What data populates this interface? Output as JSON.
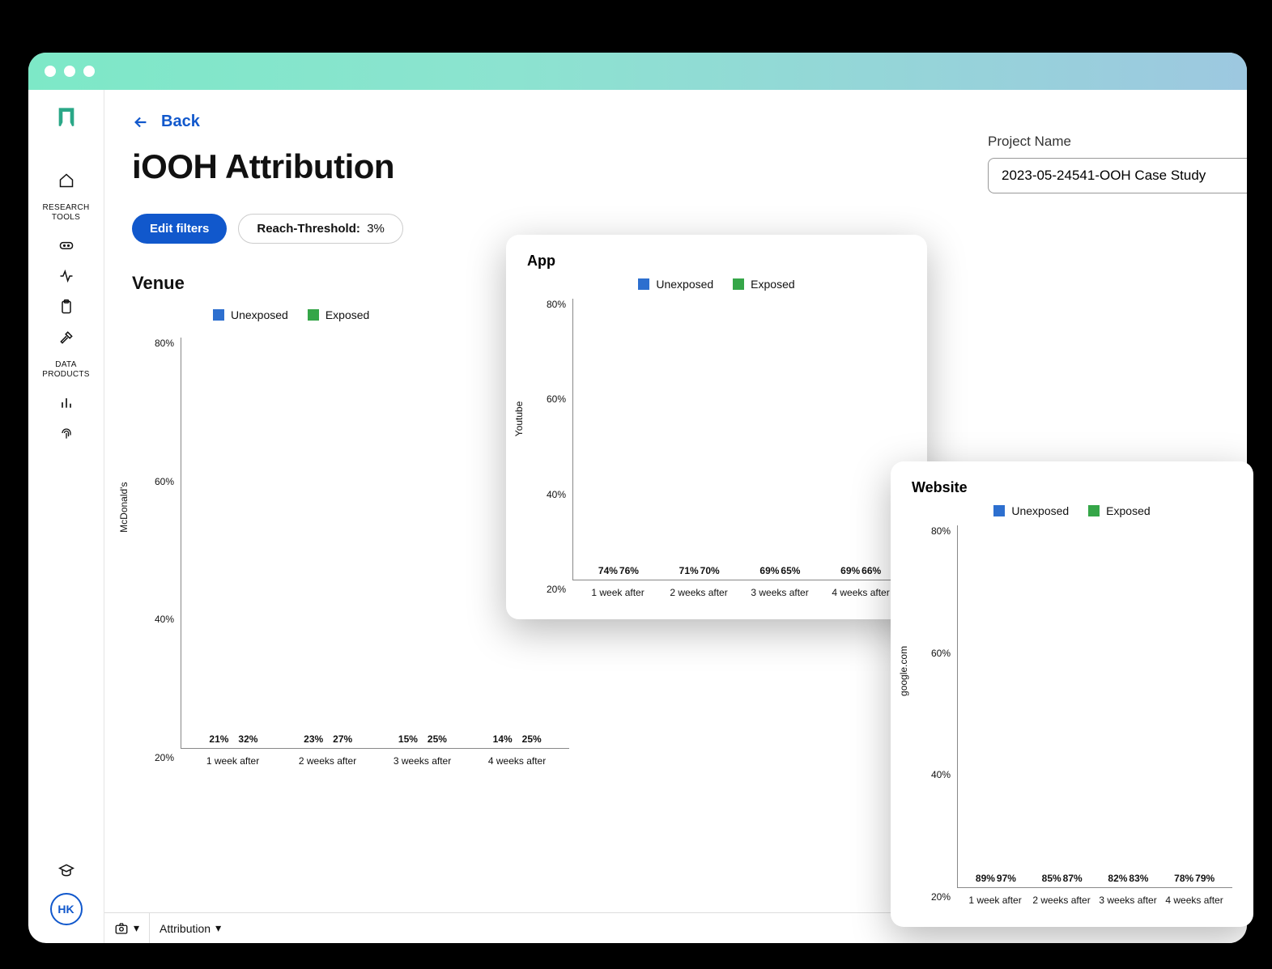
{
  "header": {
    "back_label": "Back",
    "title": "iOOH Attribution"
  },
  "project": {
    "label": "Project Name",
    "value": "2023-05-24541-OOH Case Study"
  },
  "filters": {
    "edit_label": "Edit filters",
    "threshold_label": "Reach-Threshold:",
    "threshold_value": "3%"
  },
  "sidebar": {
    "section1": "RESEARCH\nTOOLS",
    "section2": "DATA\nPRODUCTS",
    "avatar": "HK"
  },
  "bottom": {
    "attribution_label": "Attribution"
  },
  "legend": {
    "unexposed": "Unexposed",
    "exposed": "Exposed"
  },
  "venue_chart": {
    "title": "Venue",
    "ylabel": "McDonald's"
  },
  "app_chart": {
    "title": "App",
    "ylabel": "Youtube"
  },
  "web_chart": {
    "title": "Website",
    "ylabel": "google.com"
  },
  "chart_data": [
    {
      "id": "venue",
      "type": "bar",
      "title": "Venue",
      "ylabel": "McDonald's",
      "ylim": [
        0,
        100
      ],
      "yticks": [
        "80%",
        "60%",
        "40%",
        "20%"
      ],
      "categories": [
        "1 week after",
        "2 weeks after",
        "3 weeks after",
        "4 weeks after"
      ],
      "series": [
        {
          "name": "Unexposed",
          "values": [
            21,
            23,
            15,
            14
          ]
        },
        {
          "name": "Exposed",
          "values": [
            32,
            27,
            25,
            25
          ]
        }
      ]
    },
    {
      "id": "app",
      "type": "bar",
      "title": "App",
      "ylabel": "Youtube",
      "ylim": [
        0,
        80
      ],
      "yticks": [
        "80%",
        "60%",
        "40%",
        "20%"
      ],
      "categories": [
        "1 week after",
        "2 weeks after",
        "3 weeks after",
        "4 weeks after"
      ],
      "series": [
        {
          "name": "Unexposed",
          "values": [
            74,
            71,
            69,
            69
          ]
        },
        {
          "name": "Exposed",
          "values": [
            76,
            70,
            65,
            66
          ]
        }
      ]
    },
    {
      "id": "website",
      "type": "bar",
      "title": "Website",
      "ylabel": "google.com",
      "ylim": [
        0,
        100
      ],
      "yticks": [
        "80%",
        "60%",
        "40%",
        "20%"
      ],
      "categories": [
        "1 week after",
        "2 weeks after",
        "3 weeks after",
        "4 weeks after"
      ],
      "series": [
        {
          "name": "Unexposed",
          "values": [
            89,
            85,
            82,
            78
          ]
        },
        {
          "name": "Exposed",
          "values": [
            97,
            87,
            83,
            79
          ]
        }
      ]
    }
  ]
}
